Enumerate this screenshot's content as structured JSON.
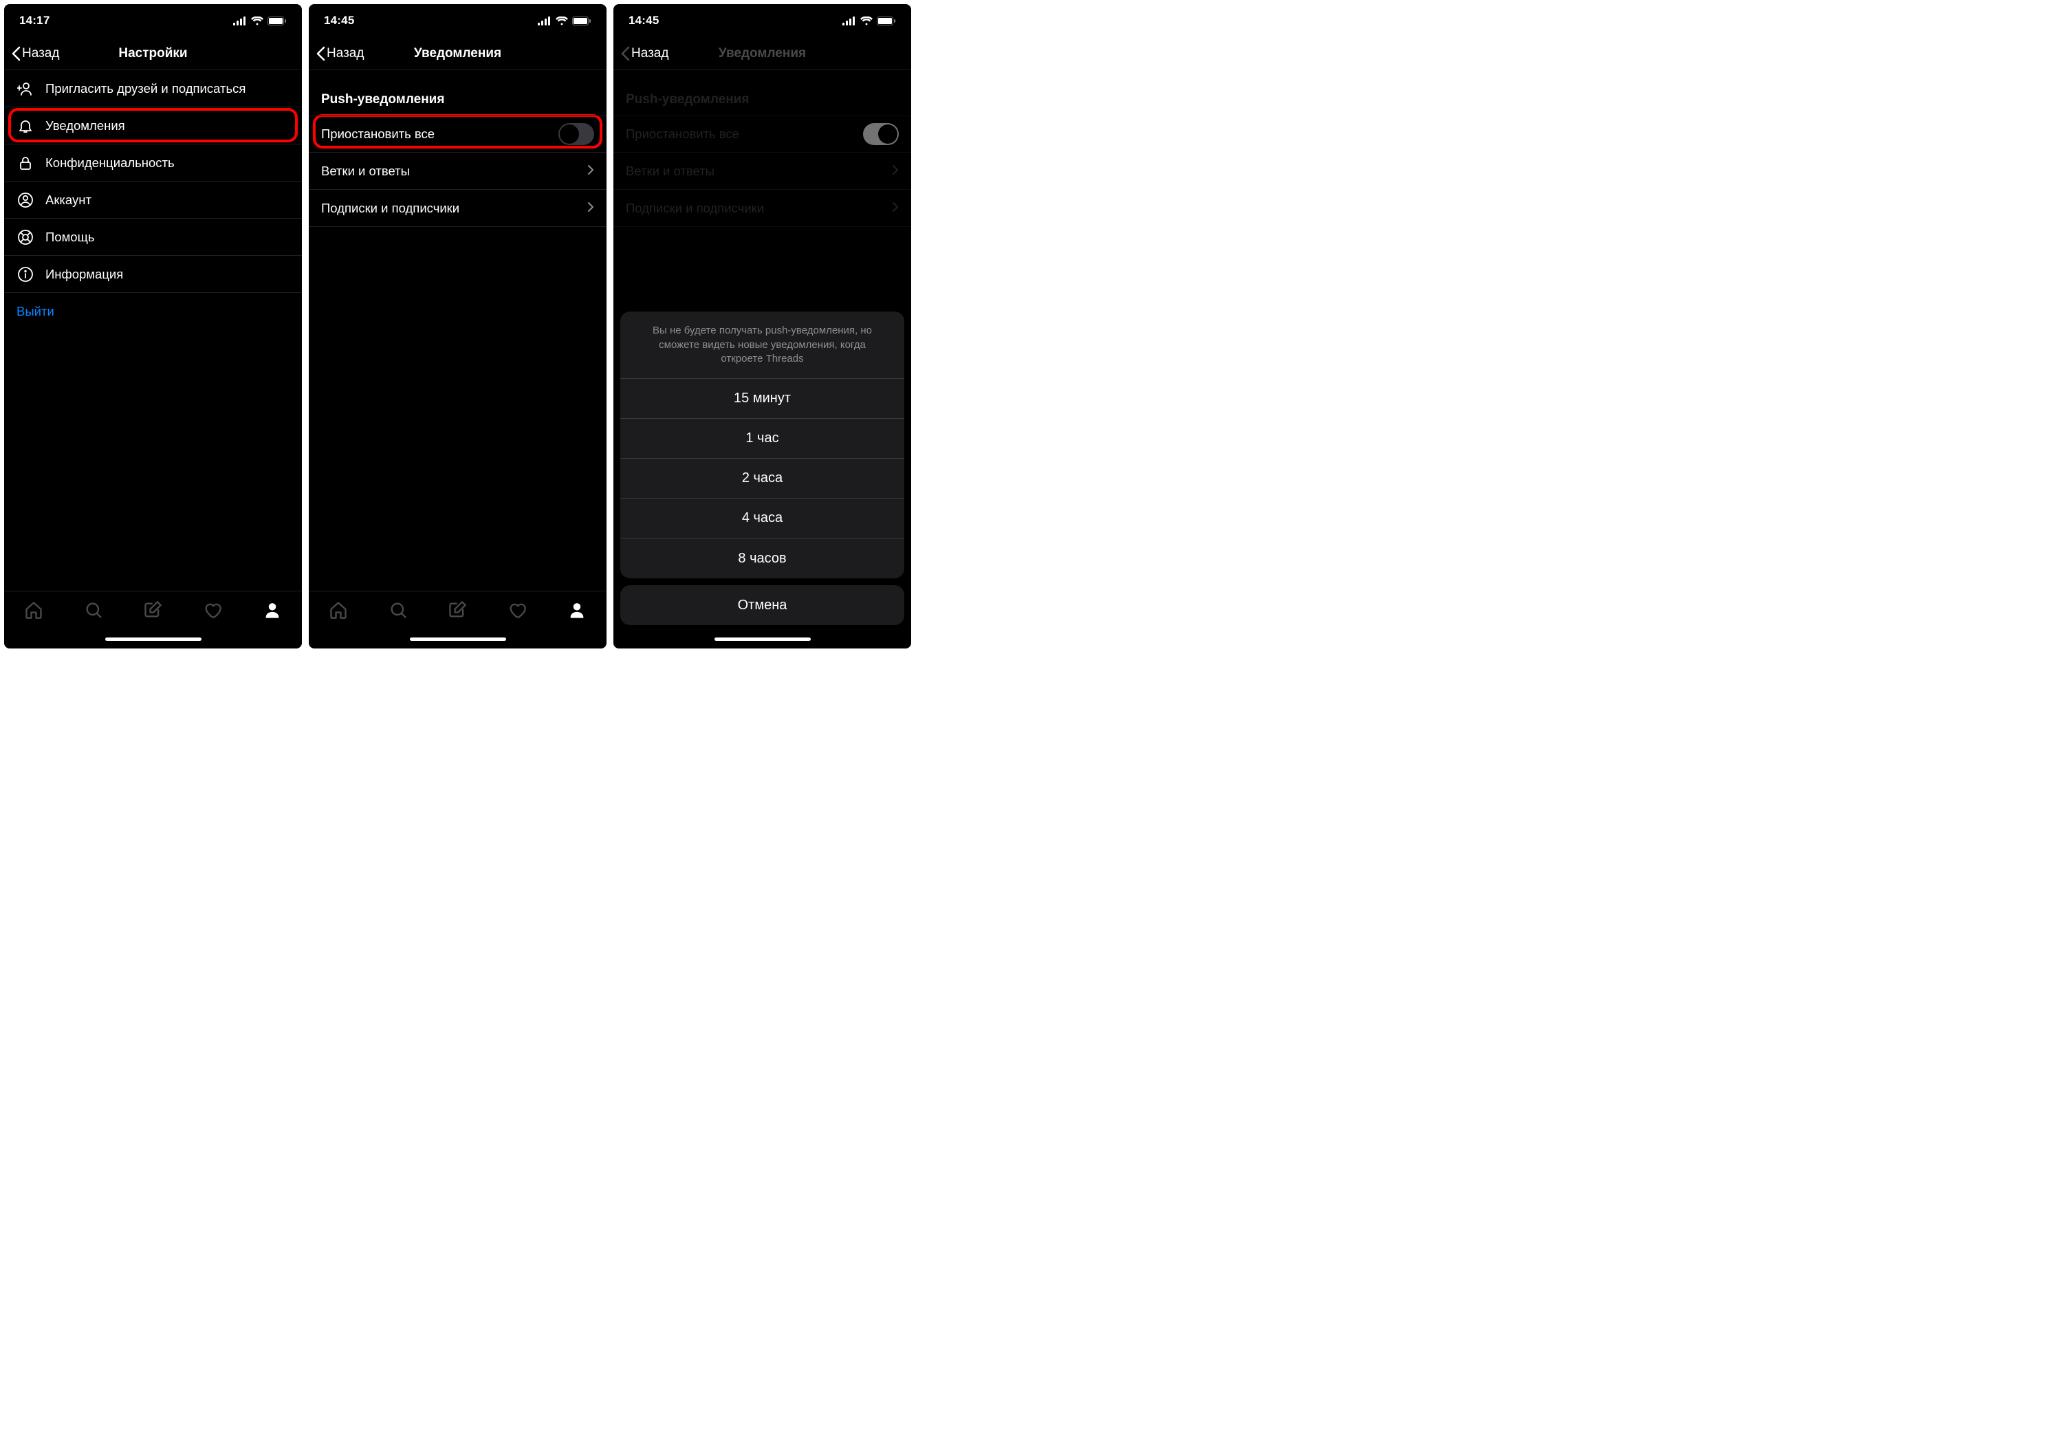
{
  "screen1": {
    "status_time": "14:17",
    "back_label": "Назад",
    "title": "Настройки",
    "items": {
      "invite": "Пригласить друзей и подписаться",
      "notifications": "Уведомления",
      "privacy": "Конфиденциальность",
      "account": "Аккаунт",
      "help": "Помощь",
      "about": "Информация",
      "logout": "Выйти"
    }
  },
  "screen2": {
    "status_time": "14:45",
    "back_label": "Назад",
    "title": "Уведомления",
    "section": "Push-уведомления",
    "items": {
      "pause_all": "Приостановить все",
      "threads_replies": "Ветки и ответы",
      "follows": "Подписки и подписчики"
    }
  },
  "screen3": {
    "status_time": "14:45",
    "back_label": "Назад",
    "title": "Уведомления",
    "section": "Push-уведомления",
    "items": {
      "pause_all": "Приостановить все",
      "threads_replies": "Ветки и ответы",
      "follows": "Подписки и подписчики"
    },
    "sheet": {
      "message": "Вы не будете получать push-уведомления, но сможете видеть новые уведомления, когда откроете Threads",
      "options": {
        "opt15m": "15 минут",
        "opt1h": "1 час",
        "opt2h": "2 часа",
        "opt4h": "4 часа",
        "opt8h": "8 часов"
      },
      "cancel": "Отмена"
    }
  }
}
